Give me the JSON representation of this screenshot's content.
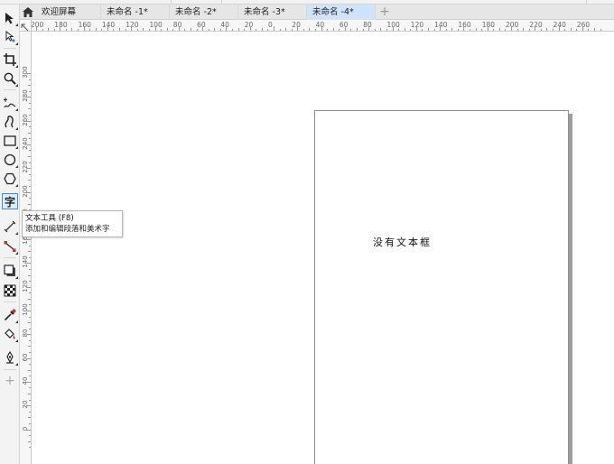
{
  "tabs": [
    {
      "label": "欢迎屏幕",
      "active": false
    },
    {
      "label": "未命名 -1*",
      "active": false
    },
    {
      "label": "未命名 -2*",
      "active": false
    },
    {
      "label": "未命名 -3*",
      "active": false
    },
    {
      "label": "未命名 -4*",
      "active": true
    }
  ],
  "toolbox": {
    "tools": [
      {
        "icon": "pointer-tool-icon"
      },
      {
        "icon": "shape-tool-icon"
      },
      {
        "icon": "crop-tool-icon"
      },
      {
        "icon": "zoom-tool-icon"
      },
      {
        "icon": "freehand-tool-icon"
      },
      {
        "icon": "artistic-media-tool-icon"
      },
      {
        "icon": "rectangle-tool-icon"
      },
      {
        "icon": "ellipse-tool-icon"
      },
      {
        "icon": "polygon-tool-icon"
      },
      {
        "icon": "text-tool-icon",
        "glyph": "字",
        "active": true
      },
      {
        "icon": "parallel-dimension-tool-icon"
      },
      {
        "icon": "connector-tool-icon"
      },
      {
        "icon": "drop-shadow-tool-icon"
      },
      {
        "icon": "transparency-tool-icon"
      },
      {
        "icon": "color-eyedropper-tool-icon"
      },
      {
        "icon": "interactive-fill-tool-icon"
      },
      {
        "icon": "smart-fill-tool-icon"
      },
      {
        "icon": "add-tool-icon",
        "glyph": "+"
      }
    ]
  },
  "ruler": {
    "top_labels": [
      "200",
      "180",
      "160",
      "140",
      "120",
      "100",
      "80",
      "60",
      "40",
      "20",
      "0",
      "20",
      "40",
      "60",
      "80",
      "100",
      "120",
      "140",
      "160",
      "180",
      "200",
      "220",
      "240",
      "260"
    ],
    "left_labels": [
      "300",
      "280",
      "260",
      "240",
      "220",
      "200",
      "180",
      "160",
      "140",
      "120",
      "100",
      "80",
      "60",
      "40",
      "20",
      "0"
    ]
  },
  "tooltip": {
    "title": "文本工具 (F8)",
    "description": "添加和编辑段落和美术字"
  },
  "page": {
    "text": "没有文本框"
  },
  "colors": {
    "active_tab": "#cfe3fa",
    "active_tool_border": "#3d8be0"
  }
}
